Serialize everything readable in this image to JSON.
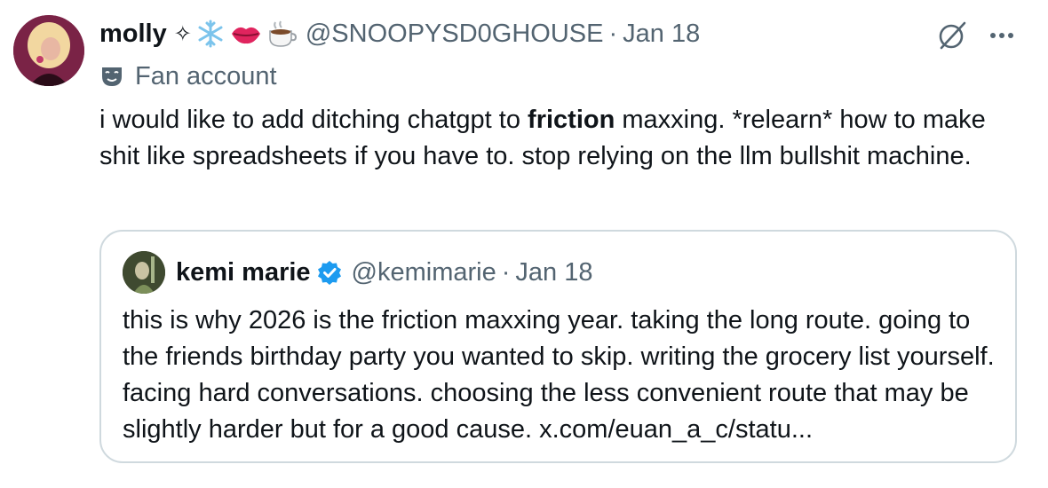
{
  "tweet": {
    "author": {
      "display_name": "molly",
      "name_symbols": "✧",
      "handle": "@SNOOPYSD0GHOUSE",
      "avatar_icon": "avatar-photo"
    },
    "separator": "·",
    "date": "Jan 18",
    "account_label": {
      "icon": "theater-mask-icon",
      "text": "Fan account"
    },
    "text_before_bold": "i would like to add ditching chatgpt to ",
    "text_bold": "friction",
    "text_after_bold": " maxxing. *relearn* how to make shit like spreadsheets if you have to. stop relying on the llm bullshit machine.",
    "actions": {
      "grok_icon": "grok-icon",
      "more_icon": "more-dots-icon"
    }
  },
  "quoted_tweet": {
    "author": {
      "display_name": "kemi marie",
      "handle": "@kemimarie",
      "verified": true,
      "verified_color": "#1d9bf0"
    },
    "separator": "·",
    "date": "Jan 18",
    "text": "this is why 2026 is the friction maxxing year. taking the long route. going to the friends birthday party you wanted to skip. writing the grocery list yourself. facing hard conversations. choosing the less convenient route that may be slightly harder but for a good cause. x.com/euan_a_c/statu..."
  },
  "colors": {
    "text_primary": "#0f1419",
    "text_secondary": "#536471",
    "border": "#cfd9de",
    "verified_blue": "#1d9bf0"
  }
}
